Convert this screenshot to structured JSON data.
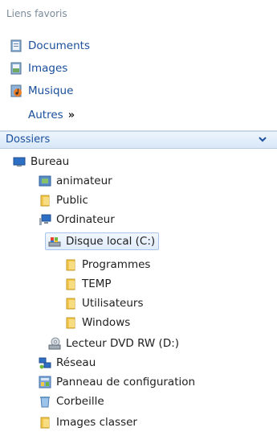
{
  "favorites": {
    "header": "Liens favoris",
    "items": [
      {
        "label": "Documents",
        "icon": "documents-icon"
      },
      {
        "label": "Images",
        "icon": "images-icon"
      },
      {
        "label": "Musique",
        "icon": "music-icon"
      }
    ],
    "more_label": "Autres",
    "more_glyph": "»"
  },
  "folders": {
    "label": "Dossiers",
    "tree": [
      {
        "label": "Bureau",
        "icon": "desktop-icon"
      },
      {
        "label": "animateur",
        "icon": "user-folder-icon"
      },
      {
        "label": "Public",
        "icon": "folder-icon"
      },
      {
        "label": "Ordinateur",
        "icon": "computer-icon"
      },
      {
        "label": "Disque local (C:)",
        "icon": "local-disk-icon",
        "selected": true
      },
      {
        "label": "Programmes",
        "icon": "folder-icon"
      },
      {
        "label": "TEMP",
        "icon": "folder-icon"
      },
      {
        "label": "Utilisateurs",
        "icon": "folder-icon"
      },
      {
        "label": "Windows",
        "icon": "folder-icon"
      },
      {
        "label": "Lecteur DVD RW (D:)",
        "icon": "dvd-drive-icon"
      },
      {
        "label": "Réseau",
        "icon": "network-icon"
      },
      {
        "label": "Panneau de configuration",
        "icon": "control-panel-icon"
      },
      {
        "label": "Corbeille",
        "icon": "recycle-bin-icon"
      },
      {
        "label": "Images classer",
        "icon": "folder-icon"
      }
    ]
  },
  "colors": {
    "link": "#1a4f9c",
    "folder_yellow": "#f2c84b",
    "selection_border": "#a8c4ea"
  }
}
